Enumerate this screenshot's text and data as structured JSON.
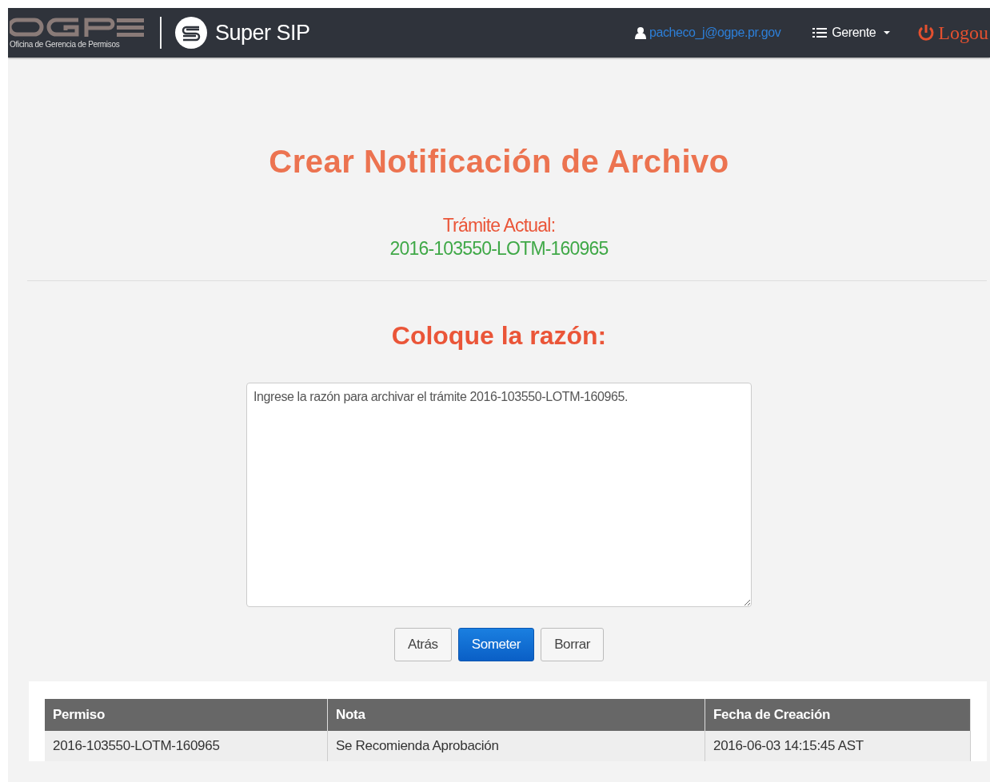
{
  "navbar": {
    "logo_subtitle": "Oficina de Gerencia de Permisos",
    "brand": "Super SIP",
    "user": "pacheco_j@ogpe.pr.gov",
    "role_menu": "Gerente",
    "logout": "Logou"
  },
  "title": "Crear Notificación de Archivo",
  "current": {
    "label": "Trámite Actual:",
    "value": "2016-103550-LOTM-160965"
  },
  "reason": {
    "heading": "Coloque la razón:",
    "value": "Ingrese la razón para archivar el trámite 2016-103550-LOTM-160965."
  },
  "buttons": [
    {
      "label": "Atrás",
      "kind": "default"
    },
    {
      "label": "Someter",
      "kind": "primary"
    },
    {
      "label": "Borrar",
      "kind": "default"
    }
  ],
  "table": {
    "columns": [
      "Permiso",
      "Nota",
      "Fecha de Creación"
    ],
    "rows": [
      [
        "2016-103550-LOTM-160965",
        "Se Recomienda Aprobación",
        "2016-06-03 14:15:45 AST"
      ]
    ]
  }
}
